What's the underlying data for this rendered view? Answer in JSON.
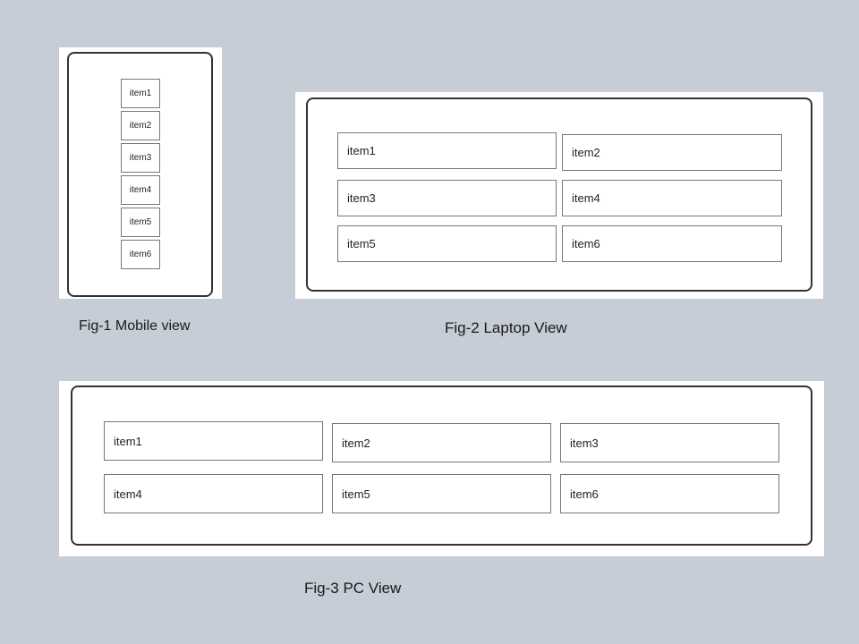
{
  "background_color": "#c6cdd6",
  "figures": {
    "mobile": {
      "caption": "Fig-1 Mobile view",
      "items": [
        "item1",
        "item2",
        "item3",
        "item4",
        "item5",
        "item6"
      ]
    },
    "laptop": {
      "caption": "Fig-2 Laptop View",
      "items": [
        "item1",
        "item2",
        "item3",
        "item4",
        "item5",
        "item6"
      ]
    },
    "pc": {
      "caption": "Fig-3 PC View",
      "items": [
        "item1",
        "item2",
        "item3",
        "item4",
        "item5",
        "item6"
      ]
    }
  }
}
